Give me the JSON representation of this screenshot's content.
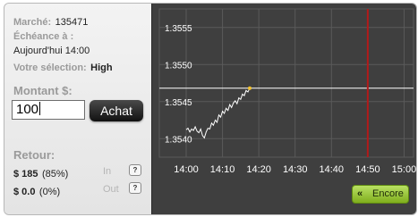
{
  "info": {
    "market_label": "Marché:",
    "market_value": "135471",
    "expiry_label": "Échéance à :",
    "expiry_value": "Aujourd'hui 14:00",
    "selection_label": "Votre sélection:",
    "selection_value": "High"
  },
  "order": {
    "amount_label": "Montant $:",
    "amount_value": "100",
    "buy_button": "Achat"
  },
  "returns": {
    "label": "Retour:",
    "in_amount": "$ 185",
    "in_percent": "(85%)",
    "in_label": "In",
    "out_amount": "$ 0.0",
    "out_percent": "(0%)",
    "out_label": "Out",
    "help_glyph": "?"
  },
  "chart_data": {
    "type": "line",
    "y_ticks": [
      "1.3555",
      "1.3550",
      "1.3545",
      "1.3540"
    ],
    "x_ticks": [
      "14:00",
      "14:10",
      "14:20",
      "14:30",
      "14:40",
      "14:50",
      "15:00"
    ],
    "xlim_minutes": [
      0,
      60
    ],
    "ylim": [
      1.35375,
      1.35575
    ],
    "strike": 1.35468,
    "expiry_marker": "14:50",
    "series": [
      {
        "x": [
          0,
          0.5,
          1,
          1.5,
          2,
          2.5,
          3,
          3.5,
          4,
          4.5,
          5,
          5.5,
          6,
          6.5,
          7,
          7.5,
          8,
          8.5,
          9,
          9.5,
          10,
          10.5,
          11,
          11.5,
          12,
          12.5,
          13,
          13.5,
          14,
          14.5,
          15,
          15.5,
          16,
          16.5,
          17,
          17.5
        ],
        "y": [
          1.35412,
          1.35414,
          1.35409,
          1.35413,
          1.35411,
          1.35416,
          1.3541,
          1.35408,
          1.35413,
          1.35404,
          1.35401,
          1.35409,
          1.35414,
          1.35413,
          1.35421,
          1.35418,
          1.35425,
          1.35422,
          1.35432,
          1.35429,
          1.35437,
          1.35434,
          1.35441,
          1.35438,
          1.35446,
          1.35442,
          1.35448,
          1.35451,
          1.35447,
          1.35455,
          1.35453,
          1.3546,
          1.35458,
          1.35465,
          1.35463,
          1.35468
        ]
      }
    ],
    "colors": {
      "background": "#3f3f3f",
      "grid": "#5a5a5a",
      "line": "#ffffff",
      "strike": "#ffffff",
      "expiry": "#b21a1a",
      "current_point": "#f2c230"
    }
  },
  "actions": {
    "more": "Encore",
    "more_icon": "double-chevron-left-icon"
  }
}
